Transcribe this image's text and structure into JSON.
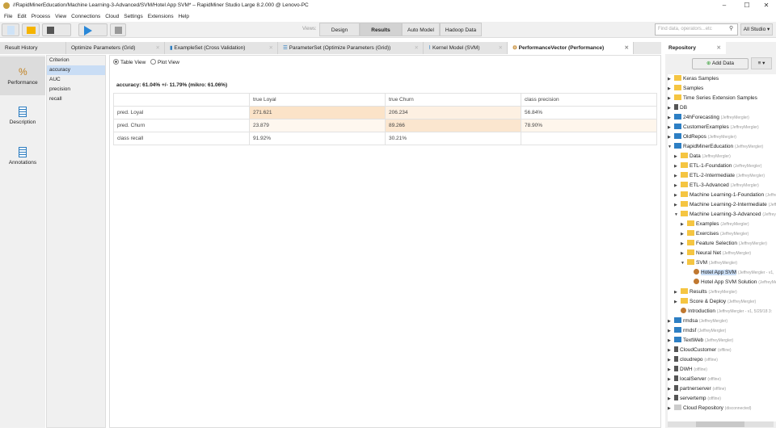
{
  "window": {
    "title": "//RapidMinerEducation/Machine Learning-3-Advanced/SVM/Hotel App SVM* – RapidMiner Studio Large 8.2.000 @ Lenovo-PC",
    "min": "–",
    "max": "☐",
    "close": "✕"
  },
  "menu": [
    "File",
    "Edit",
    "Process",
    "View",
    "Connections",
    "Cloud",
    "Settings",
    "Extensions",
    "Help"
  ],
  "toolbar": {
    "views_label": "Views:",
    "views": [
      "Design",
      "Results",
      "Auto Model",
      "Hadoop Data"
    ],
    "active_view": "Results",
    "search_placeholder": "Find data, operators...etc",
    "studio": "All Studio ▾"
  },
  "tabs": [
    {
      "label": "Result History"
    },
    {
      "label": "Optimize Parameters (Grid)"
    },
    {
      "label": "ExampleSet (Cross Validation)"
    },
    {
      "label": "ParameterSet (Optimize Parameters (Grid))"
    },
    {
      "label": "Kernel Model (SVM)"
    },
    {
      "label": "PerformanceVector (Performance)"
    }
  ],
  "leftnav": [
    {
      "label": "Performance"
    },
    {
      "label": "Description"
    },
    {
      "label": "Annotations"
    }
  ],
  "criterion": {
    "header": "Criterion",
    "items": [
      "accuracy",
      "AUC",
      "precision",
      "recall"
    ],
    "selected": "accuracy"
  },
  "view_options": {
    "table": "Table View",
    "plot": "Plot View"
  },
  "performance": {
    "title": "accuracy: 61.04% +/- 11.79% (mikro: 61.06%)",
    "header": [
      "",
      "true Loyal",
      "true Churn",
      "class precision"
    ],
    "rows": [
      [
        "pred. Loyal",
        "271.621",
        "206.234",
        "56.84%"
      ],
      [
        "pred. Churn",
        "23.879",
        "89.266",
        "78.90%"
      ],
      [
        "class recall",
        "91.92%",
        "30.21%",
        ""
      ]
    ]
  },
  "repository": {
    "title": "Repository",
    "add_data": "Add Data",
    "menu": "≡ ▾",
    "tree": [
      [
        0,
        "folder",
        "Keras Samples",
        "",
        "c"
      ],
      [
        0,
        "folder",
        "Samples",
        "",
        "c"
      ],
      [
        0,
        "folder",
        "Time Series Extension Samples",
        "",
        "c"
      ],
      [
        0,
        "db",
        "DB",
        "",
        "c"
      ],
      [
        0,
        "repo",
        "24hForecasting",
        "(JeffreyMergler)",
        "c"
      ],
      [
        0,
        "repo",
        "CustomerExamples",
        "(JeffreyMergler)",
        "c"
      ],
      [
        0,
        "repo",
        "OldRepos",
        "(JeffreyMergler)",
        "c"
      ],
      [
        0,
        "repo",
        "RapidMinerEducation",
        "(JeffreyMergler)",
        "o"
      ],
      [
        1,
        "folder",
        "Data",
        "(JeffreyMergler)",
        "c"
      ],
      [
        1,
        "folder",
        "ETL-1-Foundation",
        "(JeffreyMergler)",
        "c"
      ],
      [
        1,
        "folder",
        "ETL-2-Intermediate",
        "(JeffreyMergler)",
        "c"
      ],
      [
        1,
        "folder",
        "ETL-3-Advanced",
        "(JeffreyMergler)",
        "c"
      ],
      [
        1,
        "folder",
        "Machine Learning-1-Foundation",
        "(JeffreyMergler)",
        "c"
      ],
      [
        1,
        "folder",
        "Machine Learning-2-Intermediate",
        "(JeffreyMergler)",
        "c"
      ],
      [
        1,
        "folder",
        "Machine Learning-3-Advanced",
        "(JeffreyMergler)",
        "o"
      ],
      [
        2,
        "folder",
        "Examples",
        "(JeffreyMergler)",
        "c"
      ],
      [
        2,
        "folder",
        "Exercises",
        "(JeffreyMergler)",
        "c"
      ],
      [
        2,
        "folder",
        "Feature Selection",
        "(JeffreyMergler)",
        "c"
      ],
      [
        2,
        "folder",
        "Neural Net",
        "(JeffreyMergler)",
        "c"
      ],
      [
        2,
        "folder",
        "SVM",
        "(JeffreyMergler)",
        "o"
      ],
      [
        3,
        "proc",
        "Hotel App SVM",
        "(JeffreyMergler - v1,",
        "s"
      ],
      [
        3,
        "proc",
        "Hotel App SVM Solution",
        "(JeffreyMergler)",
        "n"
      ],
      [
        1,
        "folder",
        "Results",
        "(JeffreyMergler)",
        "c"
      ],
      [
        1,
        "folder",
        "Score & Deploy",
        "(JeffreyMergler)",
        "c"
      ],
      [
        1,
        "proc",
        "Introduction",
        "(JeffreyMergler - v1, 5/29/18 3:",
        "n"
      ],
      [
        0,
        "repo",
        "rmdsa",
        "(JeffreyMergler)",
        "c"
      ],
      [
        0,
        "repo",
        "rmdsf",
        "(JeffreyMergler)",
        "c"
      ],
      [
        0,
        "repo",
        "TextWeb",
        "(JeffreyMergler)",
        "c"
      ],
      [
        0,
        "db",
        "CloudCustomer",
        "(offline)",
        "c"
      ],
      [
        0,
        "db",
        "cloudrepo",
        "(offline)",
        "c"
      ],
      [
        0,
        "db",
        "DWH",
        "(offline)",
        "c"
      ],
      [
        0,
        "db",
        "localServer",
        "(offline)",
        "c"
      ],
      [
        0,
        "db",
        "partnerserver",
        "(offline)",
        "c"
      ],
      [
        0,
        "db",
        "servertemp",
        "(offline)",
        "c"
      ],
      [
        0,
        "cloud",
        "Cloud Repository",
        "(disconnected)",
        "c"
      ]
    ]
  }
}
